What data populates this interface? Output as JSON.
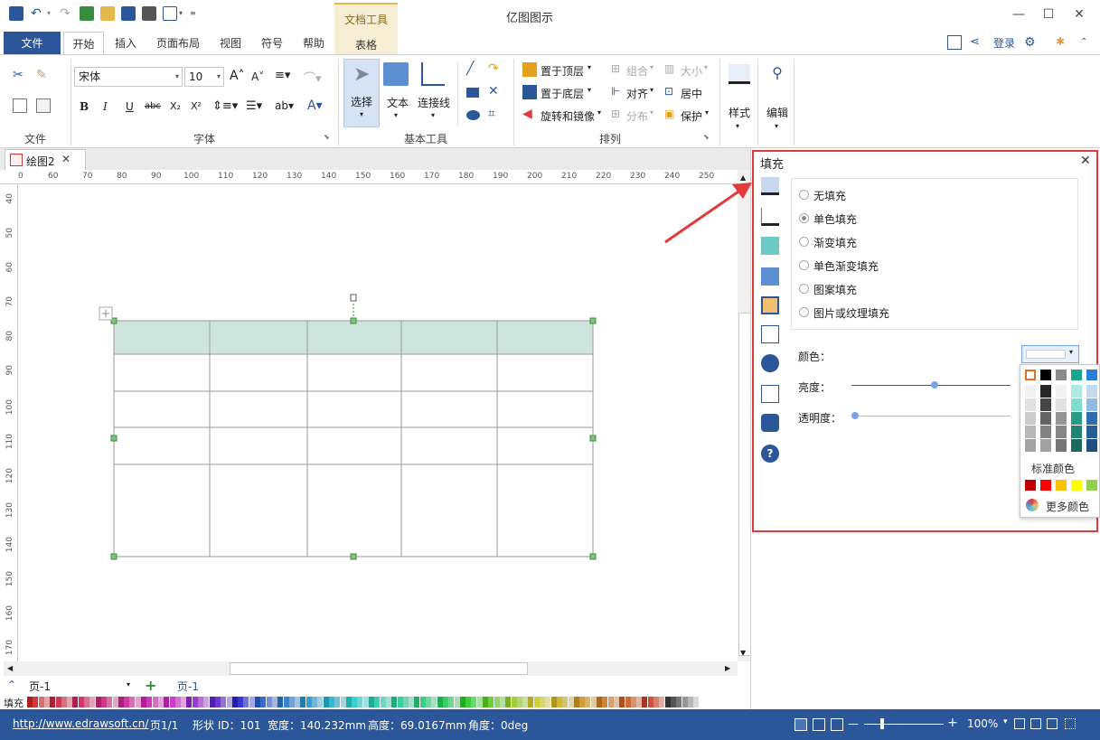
{
  "app": {
    "title": "亿图图示"
  },
  "contextual_tab": {
    "group": "文档工具",
    "tab": "表格"
  },
  "tabs": [
    "文件",
    "开始",
    "插入",
    "页面布局",
    "视图",
    "符号",
    "帮助"
  ],
  "account": {
    "login": "登录"
  },
  "ribbon": {
    "groups": {
      "file": "文件",
      "font": "字体",
      "basic_tools": "基本工具",
      "arrange": "排列",
      "style": "样式",
      "edit": "编辑"
    },
    "font_name": "宋体",
    "font_size": "10",
    "tools": {
      "select": "选择",
      "text": "文本",
      "connector": "连接线"
    },
    "arrange": {
      "bring_front": "置于顶层",
      "send_back": "置于底层",
      "rotate_mirror": "旋转和镜像",
      "group": "组合",
      "align": "对齐",
      "distribute": "分布",
      "size": "大小",
      "center": "居中",
      "protect": "保护"
    },
    "buttons": {
      "style": "样式",
      "edit": "编辑"
    }
  },
  "document_tab": {
    "name": "绘图2"
  },
  "hruler_ticks": [
    "0",
    "60",
    "70",
    "80",
    "90",
    "100",
    "110",
    "120",
    "130",
    "140",
    "150",
    "160",
    "170",
    "180",
    "190",
    "200",
    "210",
    "220",
    "230",
    "240",
    "250"
  ],
  "vruler_ticks": [
    "40",
    "50",
    "60",
    "70",
    "80",
    "90",
    "100",
    "110",
    "120",
    "130",
    "140",
    "150",
    "160",
    "170"
  ],
  "page_nav": {
    "page": "页-1",
    "current": "页-1"
  },
  "palette_label": "填充",
  "status": {
    "url": "http://www.edrawsoft.cn/",
    "page": "页1/1",
    "shape_id": "形状 ID：101",
    "width": "宽度：140.232mm",
    "height": "高度：69.0167mm",
    "angle": "角度：0deg",
    "zoom": "100%"
  },
  "panel": {
    "title": "填充",
    "fill_options": [
      "无填充",
      "单色填充",
      "渐变填充",
      "单色渐变填充",
      "图案填充",
      "图片或纹理填充"
    ],
    "selected_option": "单色填充",
    "color_label": "颜色：",
    "brightness_label": "亮度：",
    "transparency_label": "透明度：",
    "brightness_value": 0.5,
    "transparency_value": 0.0,
    "standard_colors_label": "标准颜色",
    "more_colors": "更多颜色"
  },
  "colors": {
    "ribbon_blue": "#2b579a",
    "header_fill": "#cde5dd",
    "highlight": "#e03a3a"
  }
}
